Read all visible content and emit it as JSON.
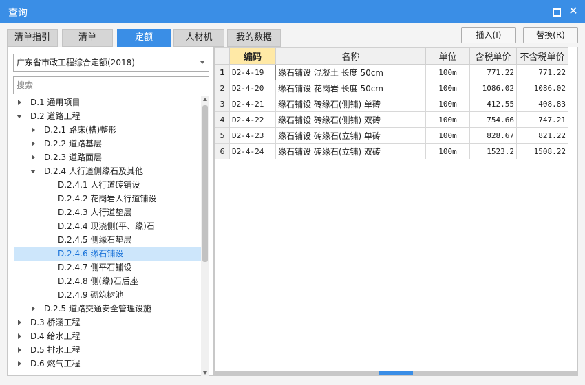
{
  "window": {
    "title": "查询"
  },
  "tabs": [
    {
      "label": "清单指引",
      "active": false
    },
    {
      "label": "清单",
      "active": false
    },
    {
      "label": "定额",
      "active": true
    },
    {
      "label": "人材机",
      "active": false
    },
    {
      "label": "我的数据",
      "active": false
    }
  ],
  "buttons": {
    "insert": "插入(I)",
    "replace": "替换(R)"
  },
  "left": {
    "library": "广东省市政工程综合定额(2018)",
    "search_placeholder": "搜索",
    "tree": [
      {
        "label": "D.1 通用项目",
        "level": 0,
        "expander": "collapsed",
        "selected": false
      },
      {
        "label": "D.2 道路工程",
        "level": 0,
        "expander": "expanded",
        "selected": false
      },
      {
        "label": "D.2.1 路床(槽)整形",
        "level": 1,
        "expander": "collapsed",
        "selected": false
      },
      {
        "label": "D.2.2 道路基层",
        "level": 1,
        "expander": "collapsed",
        "selected": false
      },
      {
        "label": "D.2.3 道路面层",
        "level": 1,
        "expander": "collapsed",
        "selected": false
      },
      {
        "label": "D.2.4 人行道侧缘石及其他",
        "level": 1,
        "expander": "expanded",
        "selected": false
      },
      {
        "label": "D.2.4.1 人行道砖铺设",
        "level": 2,
        "expander": "none",
        "selected": false
      },
      {
        "label": "D.2.4.2 花岗岩人行道铺设",
        "level": 2,
        "expander": "none",
        "selected": false
      },
      {
        "label": "D.2.4.3 人行道垫层",
        "level": 2,
        "expander": "none",
        "selected": false
      },
      {
        "label": "D.2.4.4 现浇侧(平、缘)石",
        "level": 2,
        "expander": "none",
        "selected": false
      },
      {
        "label": "D.2.4.5 侧缘石垫层",
        "level": 2,
        "expander": "none",
        "selected": false
      },
      {
        "label": "D.2.4.6 缘石铺设",
        "level": 2,
        "expander": "none",
        "selected": true
      },
      {
        "label": "D.2.4.7 侧平石铺设",
        "level": 2,
        "expander": "none",
        "selected": false
      },
      {
        "label": "D.2.4.8 侧(缘)石后座",
        "level": 2,
        "expander": "none",
        "selected": false
      },
      {
        "label": "D.2.4.9 砌筑树池",
        "level": 2,
        "expander": "none",
        "selected": false
      },
      {
        "label": "D.2.5 道路交通安全管理设施",
        "level": 1,
        "expander": "collapsed",
        "selected": false
      },
      {
        "label": "D.3 桥涵工程",
        "level": 0,
        "expander": "collapsed",
        "selected": false
      },
      {
        "label": "D.4 给水工程",
        "level": 0,
        "expander": "collapsed",
        "selected": false
      },
      {
        "label": "D.5 排水工程",
        "level": 0,
        "expander": "collapsed",
        "selected": false
      },
      {
        "label": "D.6 燃气工程",
        "level": 0,
        "expander": "collapsed",
        "selected": false
      }
    ]
  },
  "grid": {
    "columns": [
      "",
      "编码",
      "名称",
      "单位",
      "含税单价",
      "不含税单价"
    ],
    "rows": [
      {
        "n": "1",
        "code": "D2-4-19",
        "name": "缘石铺设 混凝土 长度 50cm",
        "unit": "100m",
        "price_tax": "771.22",
        "price_notax": "771.22"
      },
      {
        "n": "2",
        "code": "D2-4-20",
        "name": "缘石铺设 花岗岩 长度 50cm",
        "unit": "100m",
        "price_tax": "1086.02",
        "price_notax": "1086.02"
      },
      {
        "n": "3",
        "code": "D2-4-21",
        "name": "缘石铺设 砖缘石(侧铺) 单砖",
        "unit": "100m",
        "price_tax": "412.55",
        "price_notax": "408.83"
      },
      {
        "n": "4",
        "code": "D2-4-22",
        "name": "缘石铺设 砖缘石(侧铺) 双砖",
        "unit": "100m",
        "price_tax": "754.66",
        "price_notax": "747.21"
      },
      {
        "n": "5",
        "code": "D2-4-23",
        "name": "缘石铺设 砖缘石(立铺) 单砖",
        "unit": "100m",
        "price_tax": "828.67",
        "price_notax": "821.22"
      },
      {
        "n": "6",
        "code": "D2-4-24",
        "name": "缘石铺设 砖缘石(立铺) 双砖",
        "unit": "100m",
        "price_tax": "1523.2",
        "price_notax": "1508.22"
      }
    ]
  },
  "colors": {
    "accent": "#3a8ee6",
    "selected_row_bg": "#cde6fb",
    "header_highlight": "#ffe9a6"
  }
}
